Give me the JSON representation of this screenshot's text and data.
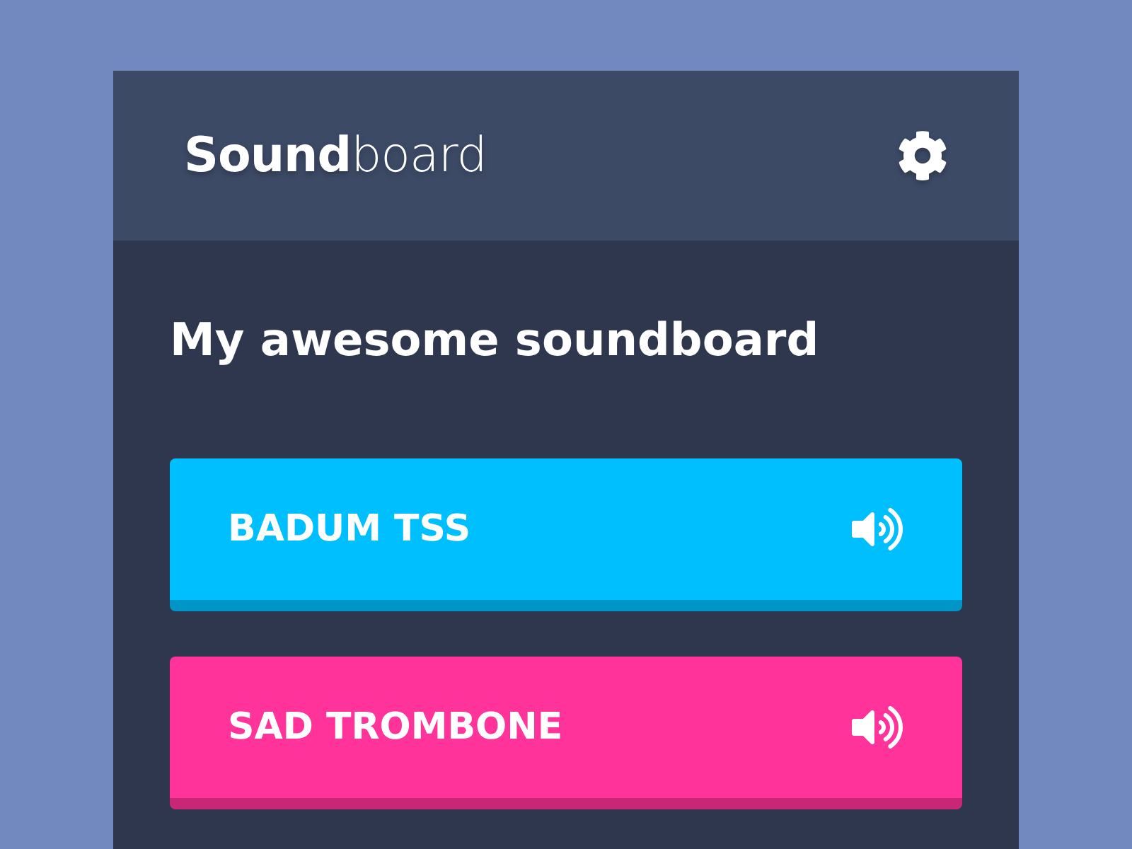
{
  "header": {
    "title": "**Sound**board"
  },
  "heading": "My awesome soundboard",
  "sounds": [
    {
      "label": "BADUM TSS",
      "color": "#00bfff"
    },
    {
      "label": "SAD TROMBONE",
      "color": "#ff3399"
    }
  ]
}
